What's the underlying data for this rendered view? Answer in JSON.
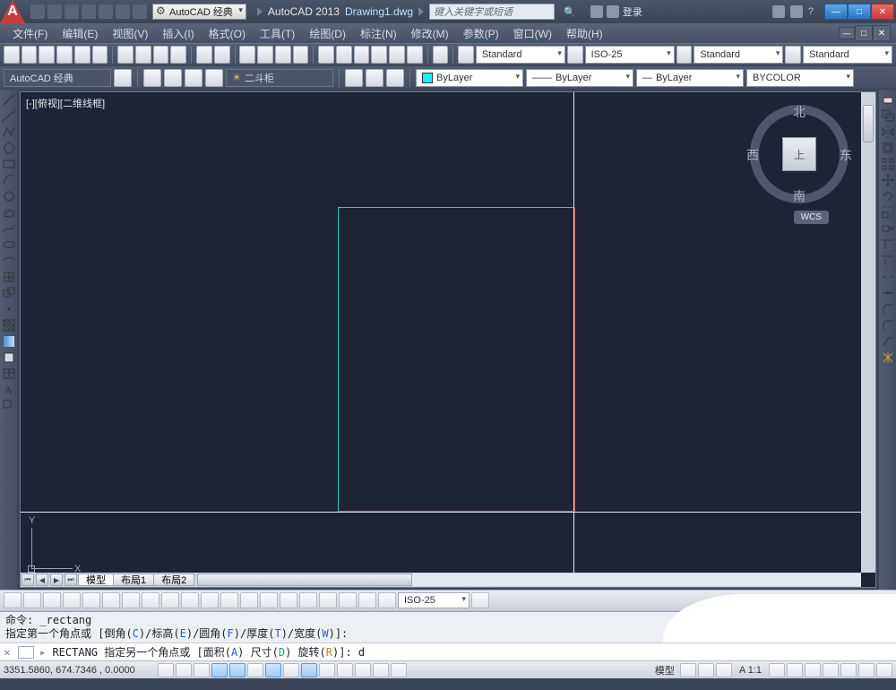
{
  "title": {
    "workspace": "AutoCAD 经典",
    "app": "AutoCAD 2013",
    "doc": "Drawing1.dwg",
    "search_placeholder": "键入关键字或短语",
    "login": "登录"
  },
  "menu": {
    "file": "文件(F)",
    "edit": "编辑(E)",
    "view": "视图(V)",
    "insert": "插入(I)",
    "format": "格式(O)",
    "tools": "工具(T)",
    "draw": "绘图(D)",
    "dimension": "标注(N)",
    "modify": "修改(M)",
    "param": "参数(P)",
    "window": "窗口(W)",
    "help": "帮助(H)"
  },
  "styles": {
    "text": "Standard",
    "dim": "ISO-25",
    "table": "Standard",
    "ml": "Standard"
  },
  "workspace2": "AutoCAD 经典",
  "layer": {
    "current": "二斗柜",
    "color": "ByLayer",
    "ltype": "ByLayer",
    "lweight": "ByLayer",
    "plot_style": "BYCOLOR"
  },
  "viewport": {
    "label": "[-][俯视][二维线框]",
    "cube_top": "上",
    "n": "北",
    "s": "南",
    "w": "西",
    "e": "东",
    "wcs": "WCS"
  },
  "ucs": {
    "x": "X",
    "y": "Y"
  },
  "layout_tabs": {
    "model": "模型",
    "l1": "布局1",
    "l2": "布局2"
  },
  "dim_style_combo": "ISO-25",
  "cmd": {
    "hist1": "命令: _rectang",
    "hist2_pre": "指定第一个角点或 [倒角(",
    "hist2_c": "C",
    "hist2_m1": ")/标高(",
    "hist2_e": "E",
    "hist2_m2": ")/圆角(",
    "hist2_f": "F",
    "hist2_m3": ")/厚度(",
    "hist2_t": "T",
    "hist2_m4": ")/宽度(",
    "hist2_w": "W",
    "hist2_end": ")]:",
    "cur_pre": "RECTANG 指定另一个角点或 [面积(",
    "cur_a": "A",
    "cur_m1": ") 尺寸(",
    "cur_d": "D",
    "cur_m2": ") 旋转(",
    "cur_r": "R",
    "cur_end": ")]: d"
  },
  "status": {
    "coords": "3351.5860, 674.7346 , 0.0000",
    "model": "模型",
    "scale": "A 1:1"
  }
}
